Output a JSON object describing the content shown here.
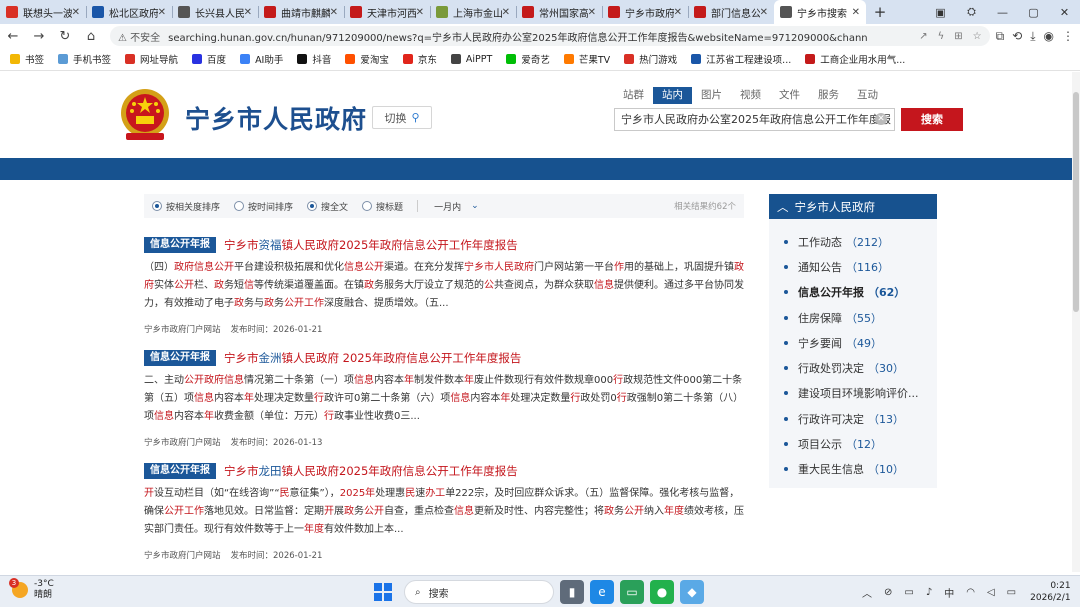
{
  "browser": {
    "tabs": [
      {
        "label": "联想头一波",
        "color": "#d93025"
      },
      {
        "label": "松北区政府",
        "color": "#1a56a8"
      },
      {
        "label": "长兴县人民",
        "color": "#555555"
      },
      {
        "label": "曲靖市麒麟",
        "color": "#c41a1a"
      },
      {
        "label": "天津市河西",
        "color": "#c41a1a"
      },
      {
        "label": "上海市金山",
        "color": "#7a9a3a"
      },
      {
        "label": "常州国家高",
        "color": "#c41a1a"
      },
      {
        "label": "宁乡市政府",
        "color": "#c41a1a"
      },
      {
        "label": "部门信息公",
        "color": "#c41a1a"
      },
      {
        "label": "宁乡市搜索",
        "color": "#555555"
      }
    ],
    "active_tab_index": 9,
    "new_tab_label": "+",
    "insecure_label": "不安全",
    "url": "searching.hunan.gov.cn/hunan/971209000/news?q=宁乡市人民政府办公室2025年政府信息公开工作年度报告&websiteName=971209000&channelName=信息公开年报&searchfi..."
  },
  "bookmarks": [
    {
      "label": "书签",
      "color": "#f2b705"
    },
    {
      "label": "手机书签",
      "color": "#5b9bd5"
    },
    {
      "label": "网址导航",
      "color": "#d93025"
    },
    {
      "label": "百度",
      "color": "#2932e1"
    },
    {
      "label": "AI助手",
      "color": "#3b82f6"
    },
    {
      "label": "抖音",
      "color": "#111111"
    },
    {
      "label": "爱淘宝",
      "color": "#ff5000"
    },
    {
      "label": "京东",
      "color": "#e1251b"
    },
    {
      "label": "AiPPT",
      "color": "#444444"
    },
    {
      "label": "爱奇艺",
      "color": "#00be06"
    },
    {
      "label": "芒果TV",
      "color": "#ff7a00"
    },
    {
      "label": "热门游戏",
      "color": "#d93025"
    },
    {
      "label": "江苏省工程建设项...",
      "color": "#1a56a8"
    },
    {
      "label": "工商企业用水用气...",
      "color": "#c41a1a"
    }
  ],
  "site": {
    "title": "宁乡市人民政府",
    "switch_label": "切换",
    "search_tabs": [
      "站群",
      "站内",
      "图片",
      "视频",
      "文件",
      "服务",
      "互动"
    ],
    "active_search_tab": 1,
    "search_query": "宁乡市人民政府办公室2025年政府信息公开工作年度报",
    "search_button": "搜索"
  },
  "filters": {
    "sort_relevance": "按相关度排序",
    "sort_time": "按时间排序",
    "scope_full": "搜全文",
    "scope_title": "搜标题",
    "time_range": "一月内",
    "result_count": "相关结果约62个"
  },
  "results": [
    {
      "badge": "信息公开年报",
      "title_pre": "宁乡市",
      "title_key": "资福",
      "title_post": "镇人民政府2025年政府信息公开工作年度报告",
      "snippet_html": "（四）<span class=\"hl\">政府信息公开</span>平台建设积极拓展和优化<span class=\"hl\">信息公开</span>渠道。在充分发挥<span class=\"hl\">宁乡市人民政府</span>门户网站第一平台<span class=\"hl\">作</span>用的基础上，巩固提升镇<span class=\"hl\">政府</span>实体<span class=\"hl\">公开</span>栏、<span class=\"hl\">政</span>务短<span class=\"hl\">信</span>等传统渠道覆盖面。在镇<span class=\"hl\">政</span>务服务大厅设立了规范的<span class=\"hl\">公</span>共查阅点，为群众获取<span class=\"hl\">信息</span>提供便利。通过多平台协同发力，有效推动了电子<span class=\"hl\">政</span>务与<span class=\"hl\">政</span>务<span class=\"hl\">公开工作</span>深度融合、提质增效。（五...",
      "source": "宁乡市政府门户网站",
      "date": "发布时间：2026-01-21"
    },
    {
      "badge": "信息公开年报",
      "title_pre": "宁乡市",
      "title_key": "金洲",
      "title_post": "镇人民政府 2025年政府信息公开工作年度报告",
      "snippet_html": "二、主动<span class=\"hl\">公开政府信息</span>情况第二十条第（一）项<span class=\"hl\">信息</span>内容本<span class=\"hl\">年</span>制发件数本<span class=\"hl\">年</span>废止件数现行有效件数规章000<span class=\"hl\">行</span>政规范性文件000第二十条第（五）项<span class=\"hl\">信息</span>内容本<span class=\"hl\">年</span>处理决定数量<span class=\"hl\">行</span>政许可0第二十条第（六）项<span class=\"hl\">信息</span>内容本<span class=\"hl\">年</span>处理决定数量<span class=\"hl\">行</span>政处罚0<span class=\"hl\">行</span>政强制0第二十条第（八）项<span class=\"hl\">信息</span>内容本<span class=\"hl\">年</span>收费金额（单位：万元）<span class=\"hl\">行</span>政事业性收费0三...",
      "source": "宁乡市政府门户网站",
      "date": "发布时间：2026-01-13"
    },
    {
      "badge": "信息公开年报",
      "title_pre": "宁乡市",
      "title_key": "龙田",
      "title_post": "镇人民政府2025年政府信息公开工作年度报告",
      "snippet_html": "<span class=\"hl\">开</span>设互动栏目（如“在线咨询”“<span class=\"hl\">民</span>意征集”），<span class=\"hl\">2025年</span>处理惠<span class=\"hl\">民</span>速<span class=\"hl\">办工</span>单222宗，及时回应群众诉求。（五）监督保障。强化考核与监督，确保<span class=\"hl\">公开工作</span>落地见效。日常监督：定期<span class=\"hl\">开</span>展<span class=\"hl\">政</span>务<span class=\"hl\">公开</span>自查，重点检查<span class=\"hl\">信息</span>更新及时性、内容完整性；将<span class=\"hl\">政</span>务<span class=\"hl\">公开</span>纳入<span class=\"hl\">年度</span>绩效考核，压实部门责任。现行有效件数等于上一<span class=\"hl\">年度</span>有效件数加上本...",
      "source": "宁乡市政府门户网站",
      "date": "发布时间：2026-01-21"
    }
  ],
  "sidebar": {
    "title": "宁乡市人民政府",
    "items": [
      {
        "label": "工作动态",
        "count": "（212）"
      },
      {
        "label": "通知公告",
        "count": "（116）"
      },
      {
        "label": "信息公开年报",
        "count": "（62）",
        "active": true
      },
      {
        "label": "住房保障",
        "count": "（55）"
      },
      {
        "label": "宁乡要闻",
        "count": "（49）"
      },
      {
        "label": "行政处罚决定",
        "count": "（30）"
      },
      {
        "label": "建设项目环境影响评价...",
        "count": ""
      },
      {
        "label": "行政许可决定",
        "count": "（13）"
      },
      {
        "label": "项目公示",
        "count": "（12）"
      },
      {
        "label": "重大民生信息",
        "count": "（10）"
      }
    ]
  },
  "taskbar": {
    "weather_badge": "3",
    "temperature": "-3°C",
    "condition": "晴朗",
    "search_placeholder": "搜索",
    "ime": "中",
    "time": "0:21",
    "date": "2026/2/1"
  }
}
